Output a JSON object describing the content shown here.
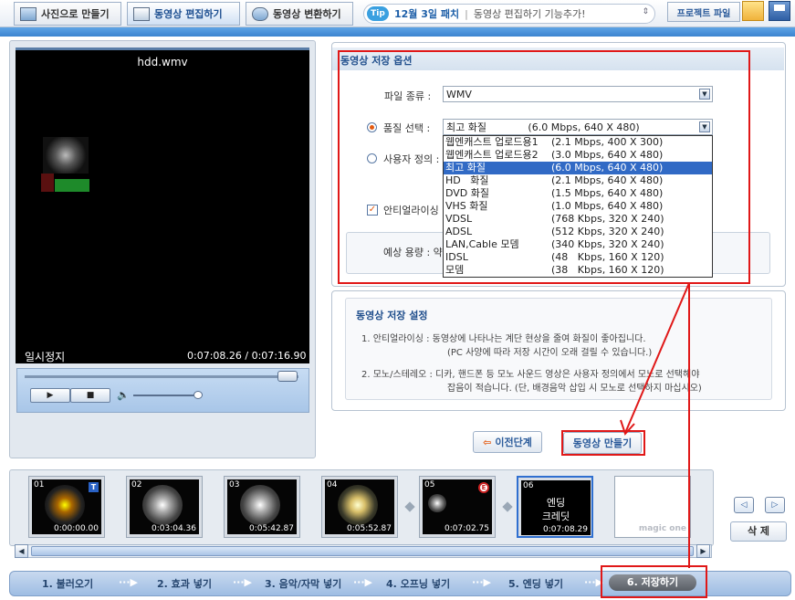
{
  "toolbar": {
    "tabs": [
      {
        "label": "사진으로 만들기"
      },
      {
        "label": "동영상 편집하기"
      },
      {
        "label": "동영상 변환하기"
      }
    ],
    "tip_badge": "Tip",
    "tip_date": "12월 3일 패치",
    "tip_text": "동영상 편집하기 기능추가!",
    "project_label": "프로젝트 파일"
  },
  "preview": {
    "file_name": "hdd.wmv",
    "status": "일시정지",
    "time": "0:07:08.26 / 0:07:16.90"
  },
  "save_options": {
    "title": "동영상 저장 옵션",
    "file_type_label": "파일 종류 :",
    "file_type_value": "WMV",
    "quality_label": "품질 선택 :",
    "quality_value": "최고 화질             (6.0 Mbps, 640 X 480)",
    "custom_label": "사용자 정의 :",
    "antialias_label": "안티얼라이싱",
    "estimate_label": "예상 용량 : 약",
    "quality_options": [
      {
        "name": "웹엔캐스트 업로드용1",
        "spec": "(2.1 Mbps, 400 X 300)"
      },
      {
        "name": "웹엔캐스트 업로드용2",
        "spec": "(3.0 Mbps, 640 X 480)"
      },
      {
        "name": "최고 화질",
        "spec": "(6.0 Mbps, 640 X 480)"
      },
      {
        "name": "HD   화질",
        "spec": "(2.1 Mbps, 640 X 480)"
      },
      {
        "name": "DVD 화질",
        "spec": "(1.5 Mbps, 640 X 480)"
      },
      {
        "name": "VHS 화질",
        "spec": "(1.0 Mbps, 640 X 480)"
      },
      {
        "name": "VDSL",
        "spec": "(768 Kbps, 320 X 240)"
      },
      {
        "name": "ADSL",
        "spec": "(512 Kbps, 320 X 240)"
      },
      {
        "name": "LAN,Cable 모뎀",
        "spec": "(340 Kbps, 320 X 240)"
      },
      {
        "name": "IDSL",
        "spec": "(48   Kbps, 160 X 120)"
      },
      {
        "name": "모뎀",
        "spec": "(38   Kbps, 160 X 120)"
      }
    ],
    "selected_index": 2
  },
  "save_settings": {
    "title": "동영상 저장 설정",
    "line1_label": "1. 안티얼라이싱 : ",
    "line1_text": "동영상에 나타나는 계단 현상을 줄여 화질이 좋아집니다.",
    "line1_note": "(PC 사양에 따라 저장 시간이 오래 걸릴 수 있습니다.)",
    "line2_label": "2. 모노/스테레오 : ",
    "line2_text": "디카, 핸드폰 등 모노 사운드 영상은 사용자 정의에서 모노로 선택해야",
    "line2_note": "잡음이 적습니다. (단, 배경음악 삽입 시 모노로 선택하지 마십시오)"
  },
  "actions": {
    "prev_label": "이전단계",
    "make_label": "동영상 만들기"
  },
  "timeline": {
    "clips": [
      {
        "num": "01",
        "time": "0:00:00.00",
        "badge": "T"
      },
      {
        "num": "02",
        "time": "0:03:04.36",
        "badge": ""
      },
      {
        "num": "03",
        "time": "0:05:42.87",
        "badge": ""
      },
      {
        "num": "04",
        "time": "0:05:52.87",
        "badge": ""
      },
      {
        "num": "05",
        "time": "0:07:02.75",
        "badge": "E"
      }
    ],
    "ending_num": "06",
    "ending_text1": "엔딩",
    "ending_text2": "크레딧",
    "ending_time": "0:07:08.29",
    "logo_text": "magic one",
    "delete_label": "삭  제"
  },
  "steps": [
    {
      "label": "1. 불러오기"
    },
    {
      "label": "2. 효과 넣기"
    },
    {
      "label": "3. 음악/자막 넣기"
    },
    {
      "label": "4. 오프닝 넣기"
    },
    {
      "label": "5. 엔딩 넣기"
    },
    {
      "label": "6. 저장하기"
    }
  ],
  "colors": {
    "accent": "#316ac5",
    "annotation": "#e01818",
    "header_blue": "#3c84d0"
  }
}
